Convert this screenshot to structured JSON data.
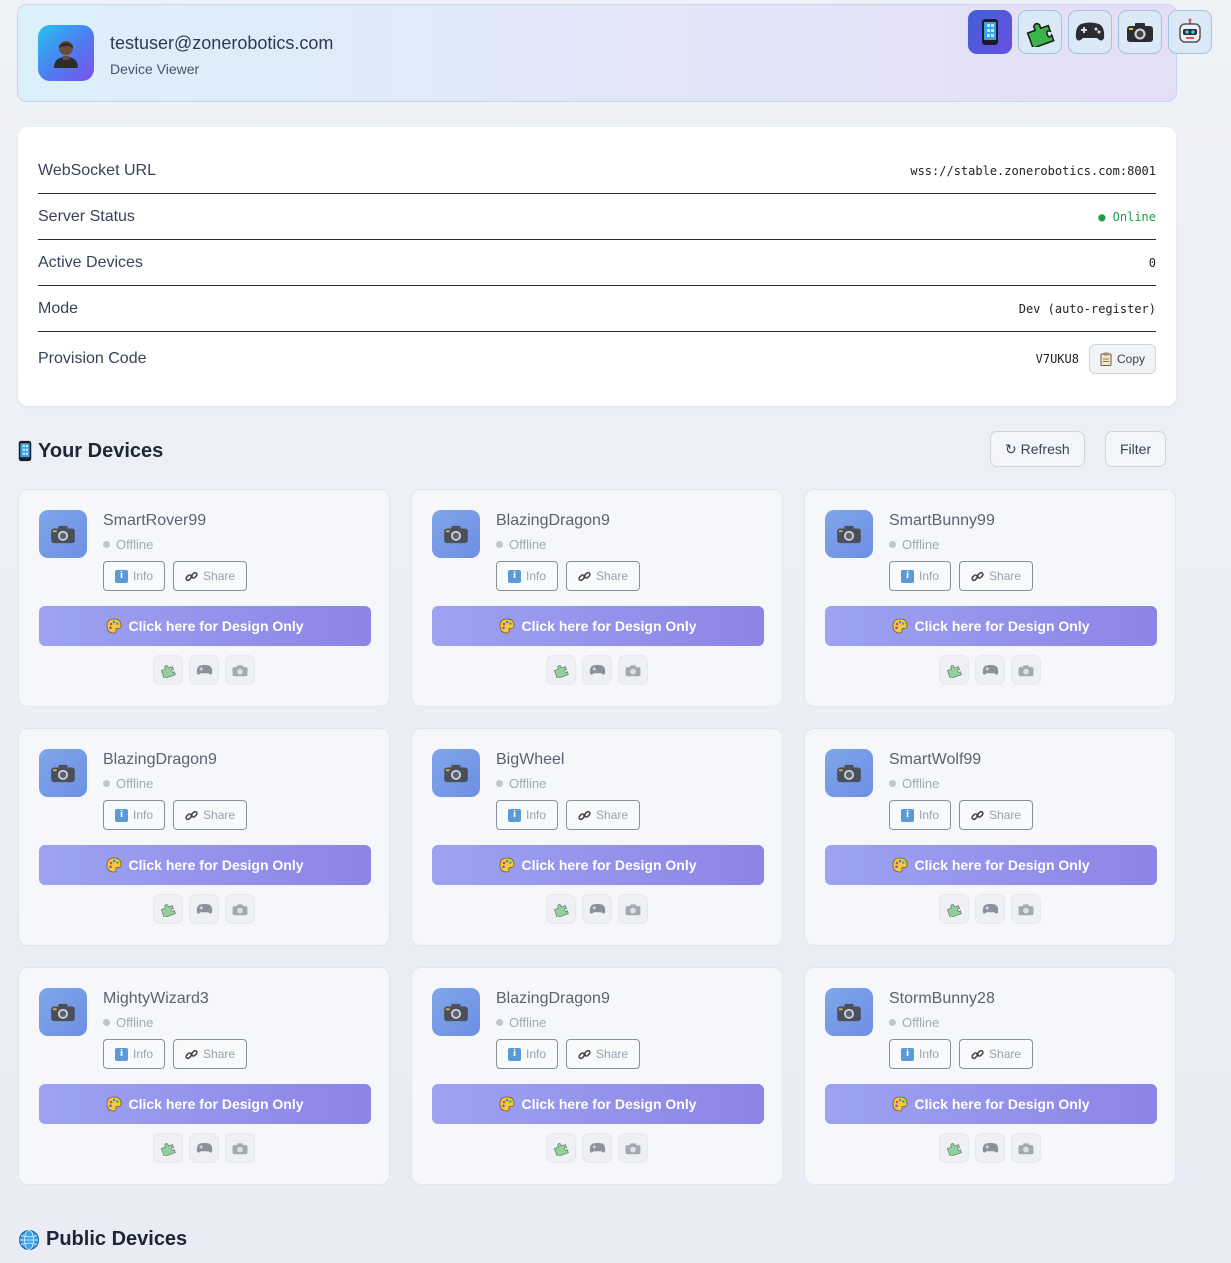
{
  "header": {
    "email": "testuser@zonerobotics.com",
    "role": "Device Viewer"
  },
  "topbar": {
    "icons": [
      "phone-icon",
      "puzzle-icon",
      "gamepad-icon",
      "camera-icon",
      "robot-icon"
    ],
    "active_index": 0
  },
  "server_info": {
    "rows": [
      {
        "label": "WebSocket URL",
        "value": "wss://stable.zonerobotics.com:8001"
      },
      {
        "label": "Server Status",
        "value": "● Online"
      },
      {
        "label": "Active Devices",
        "value": "0"
      },
      {
        "label": "Mode",
        "value": "Dev (auto-register)"
      }
    ],
    "provision_label": "Provision Code",
    "provision_code": "V7UKU8",
    "copy_label": "Copy"
  },
  "your_devices": {
    "title": "Your Devices",
    "refresh_label": "↻ Refresh",
    "filter_label": "Filter"
  },
  "device_card_labels": {
    "info": "Info",
    "share": "Share",
    "design": "Click here for Design Only"
  },
  "devices": [
    {
      "name": "SmartRover99",
      "status": "Offline"
    },
    {
      "name": "BlazingDragon9",
      "status": "Offline"
    },
    {
      "name": "SmartBunny99",
      "status": "Offline"
    },
    {
      "name": "BlazingDragon9",
      "status": "Offline"
    },
    {
      "name": "BigWheel",
      "status": "Offline"
    },
    {
      "name": "SmartWolf99",
      "status": "Offline"
    },
    {
      "name": "MightyWizard3",
      "status": "Offline"
    },
    {
      "name": "BlazingDragon9",
      "status": "Offline"
    },
    {
      "name": "StormBunny28",
      "status": "Offline"
    }
  ],
  "public_devices": {
    "title": "Public Devices"
  },
  "colors": {
    "accent": "#8c84e6",
    "online": "#1e9e4a",
    "offline": "#a4a9b5"
  }
}
